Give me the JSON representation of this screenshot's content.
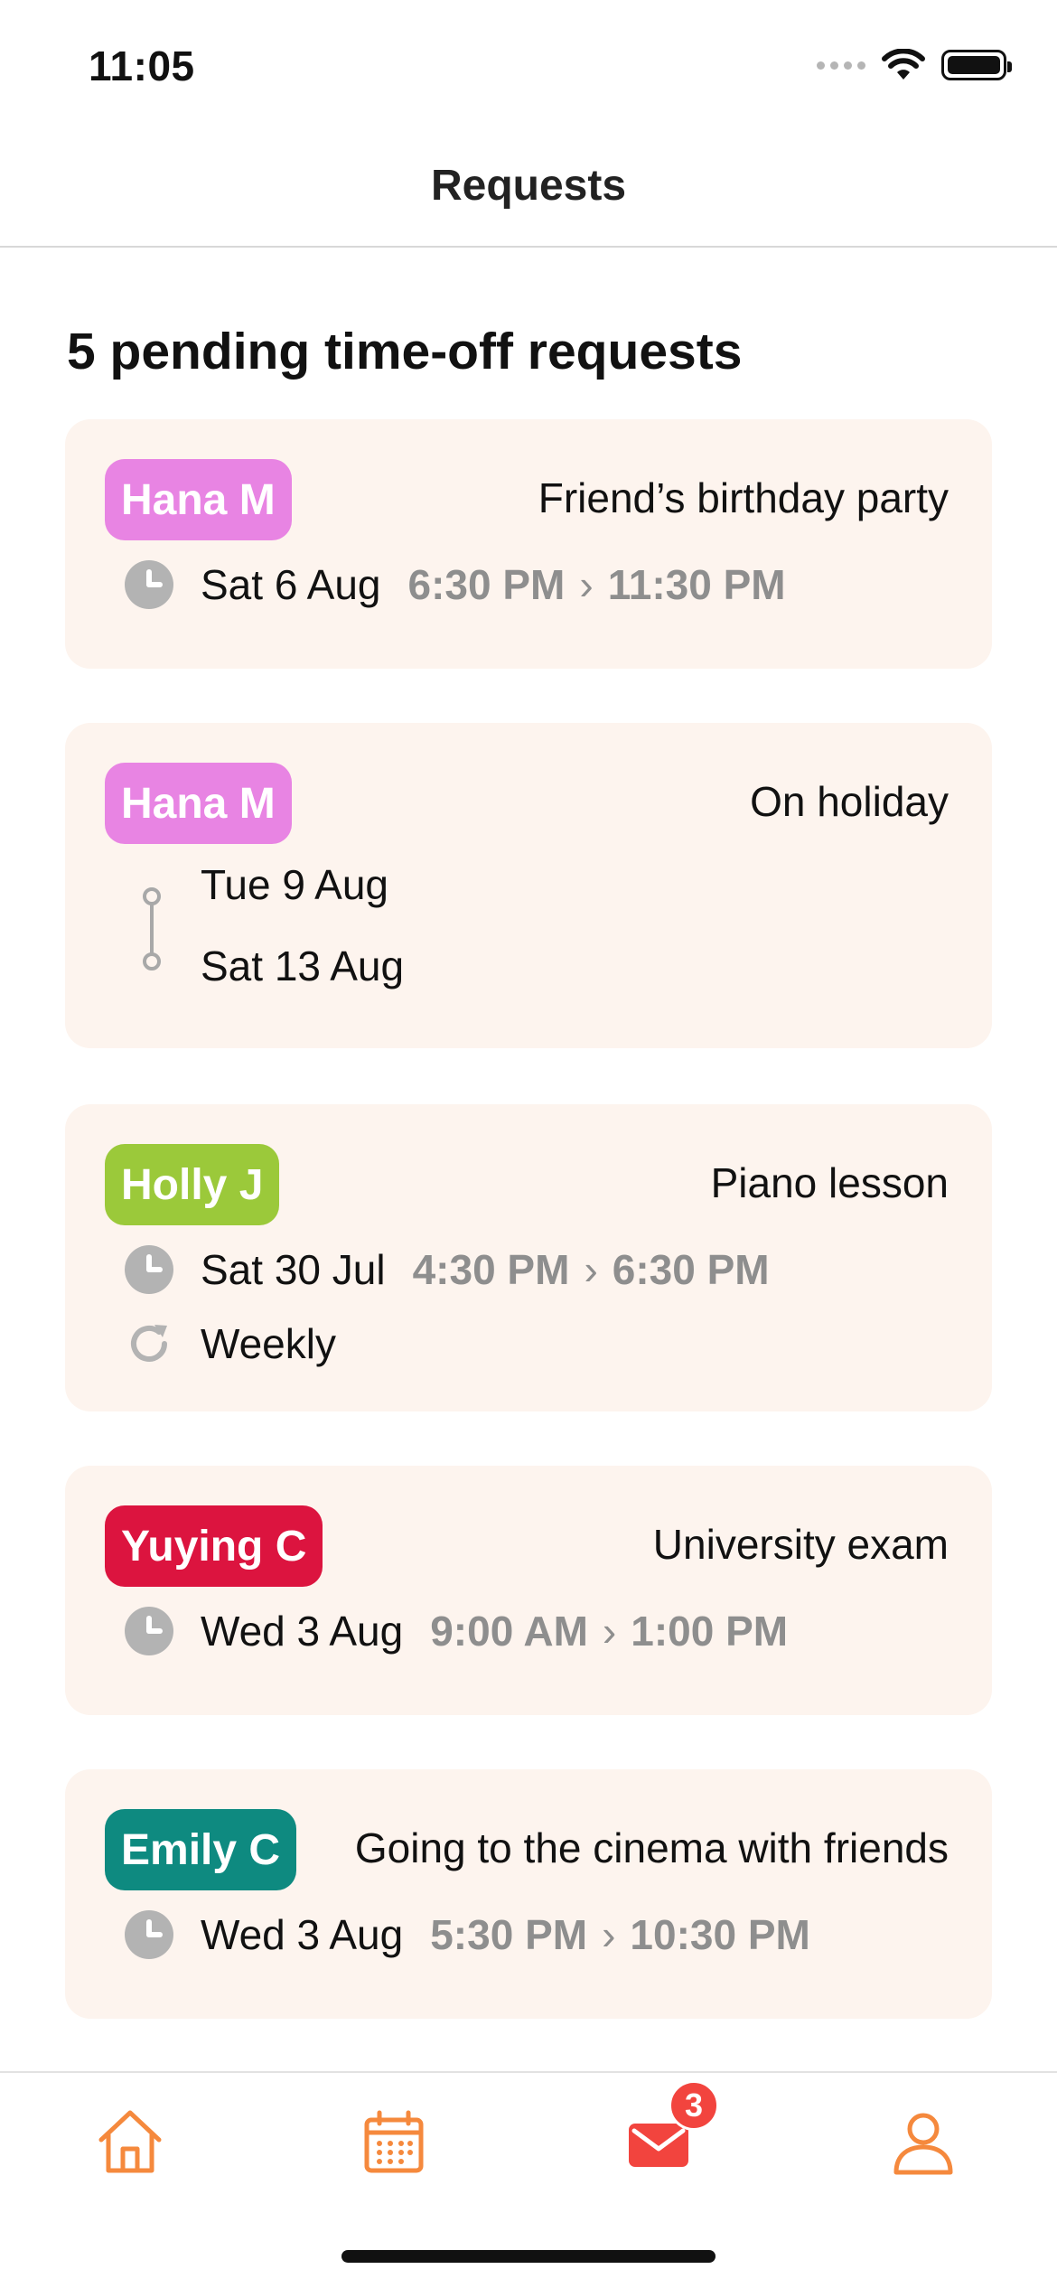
{
  "status_bar": {
    "time": "11:05"
  },
  "nav": {
    "title": "Requests"
  },
  "heading": "5 pending time-off requests",
  "requests": [
    {
      "name": "Hana M",
      "color": "#e884e3",
      "reason": "Friend’s birthday party",
      "date": "Sat 6 Aug",
      "start": "6:30 PM",
      "end": "11:30 PM"
    },
    {
      "name": "Hana M",
      "color": "#e884e3",
      "reason": "On holiday",
      "range_start": "Tue 9 Aug",
      "range_end": "Sat 13 Aug"
    },
    {
      "name": "Holly J",
      "color": "#9bc93a",
      "reason": "Piano lesson",
      "date": "Sat 30 Jul",
      "start": "4:30 PM",
      "end": "6:30 PM",
      "repeat": "Weekly"
    },
    {
      "name": "Yuying C",
      "color": "#dc143f",
      "reason": "University exam",
      "date": "Wed 3 Aug",
      "start": "9:00 AM",
      "end": "1:00 PM"
    },
    {
      "name": "Emily C",
      "color": "#0e8a80",
      "reason": "Going to the cinema with friends",
      "date": "Wed 3 Aug",
      "start": "5:30 PM",
      "end": "10:30 PM"
    }
  ],
  "tab_bar": {
    "tabs": [
      {
        "icon": "home-icon"
      },
      {
        "icon": "calendar-icon"
      },
      {
        "icon": "mail-icon",
        "badge": "3"
      },
      {
        "icon": "profile-icon"
      }
    ],
    "accent": "#f5893d",
    "active": "#f2443e"
  }
}
